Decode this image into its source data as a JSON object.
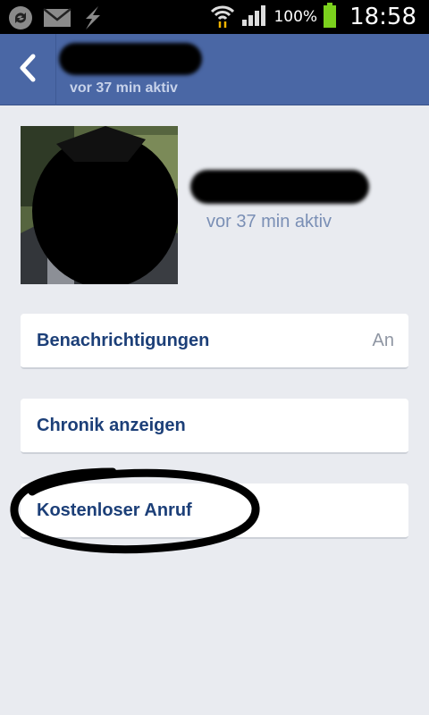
{
  "status_bar": {
    "battery_percent": "100%",
    "time": "18:58",
    "icons": [
      "sync-icon",
      "mail-icon",
      "usb-charge-icon",
      "wifi-icon",
      "signal-icon",
      "battery-icon"
    ]
  },
  "header": {
    "name_redacted": true,
    "status": "vor 37 min aktiv"
  },
  "profile": {
    "photo_redacted": true,
    "name_redacted": true,
    "status": "vor 37 min aktiv"
  },
  "menu": [
    {
      "label": "Benachrichtigungen",
      "value": "An"
    },
    {
      "label": "Chronik anzeigen"
    },
    {
      "label": "Kostenloser Anruf",
      "circled": true
    }
  ],
  "colors": {
    "header": "#4a67a5",
    "background": "#e9ebf0",
    "label": "#1c3f78",
    "battery": "#7bd11d"
  }
}
